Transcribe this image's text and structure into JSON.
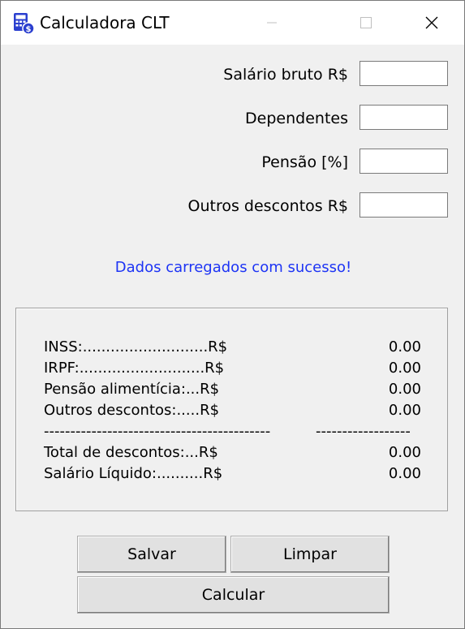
{
  "window": {
    "title": "Calculadora CLT",
    "icon": "calculator-icon",
    "controls": [
      "minimize-icon",
      "maximize-icon",
      "close-icon"
    ]
  },
  "form": {
    "fields": [
      {
        "label": "Salário bruto R$",
        "value": ""
      },
      {
        "label": "Dependentes",
        "value": ""
      },
      {
        "label": "Pensão [%]",
        "value": ""
      },
      {
        "label": "Outros descontos R$",
        "value": ""
      }
    ]
  },
  "status": {
    "message": "Dados carregados com sucesso!",
    "color": "#1d34f5"
  },
  "results": {
    "rows": [
      {
        "label": "INSS:...........................R$",
        "value": "0.00"
      },
      {
        "label": "IRPF:...........................R$",
        "value": "0.00"
      },
      {
        "label": "Pensão alimentícia:...R$",
        "value": "0.00"
      },
      {
        "label": "Outros descontos:.....R$",
        "value": "0.00"
      }
    ],
    "separator_left": "-------------------------------------------",
    "separator_right": "------------------",
    "totals": [
      {
        "label": "Total de descontos:...R$",
        "value": "0.00"
      },
      {
        "label": "Salário Líquido:..........R$",
        "value": "0.00"
      }
    ]
  },
  "buttons": {
    "save": "Salvar",
    "clear": "Limpar",
    "calculate": "Calcular"
  }
}
